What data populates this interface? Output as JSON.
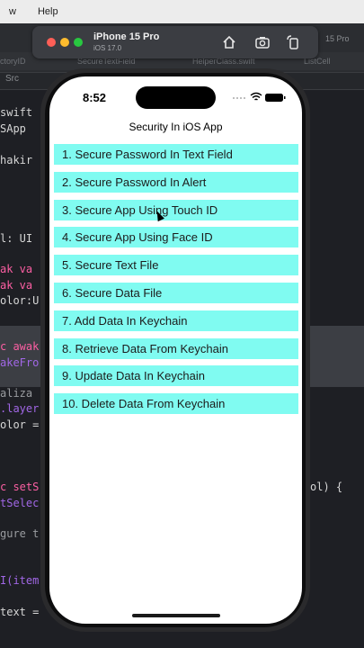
{
  "menubar": {
    "items": [
      "w",
      "Help"
    ]
  },
  "xcode": {
    "tabs": [
      "ctoryID",
      "SecureTextField",
      "HelperClass.swift",
      "ListCell"
    ],
    "crumb": "Src",
    "code_left": [
      "swift",
      "SApp",
      "hakir",
      "l: UI",
      "ak va",
      "ak va",
      "olor:U",
      "c awak",
      "akeFro",
      "aliza",
      ".layer",
      "olor =",
      "c setS",
      "tSelec",
      "gure t",
      "I(item",
      "text ="
    ],
    "code_right": [
      "ol) {"
    ]
  },
  "simulator": {
    "device": "iPhone 15 Pro",
    "os": "iOS 17.0",
    "extra_label": "15 Pro"
  },
  "phone": {
    "time": "8:52",
    "title": "Security In iOS App",
    "items": [
      "1. Secure Password In Text Field",
      "2. Secure Password In Alert",
      "3. Secure App Using Touch ID",
      "4. Secure App Using Face ID",
      "5. Secure Text File",
      "6. Secure Data File",
      "7. Add Data In Keychain",
      "8. Retrieve Data From Keychain",
      "9. Update Data In Keychain",
      "10. Delete Data From Keychain"
    ]
  }
}
